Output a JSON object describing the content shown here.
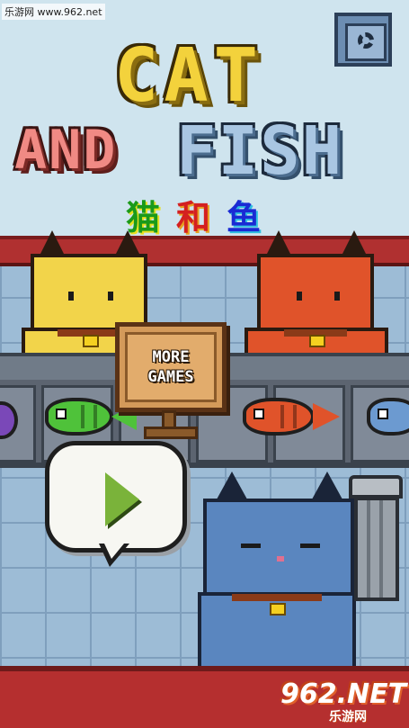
{
  "watermark": {
    "site": "乐游网 www.962.net"
  },
  "title": {
    "line1": "CAT",
    "line2_left": "AND",
    "line2_right": "FISH",
    "chinese": [
      "猫",
      "和",
      "鱼"
    ]
  },
  "buttons": {
    "more_games": "MORE GAMES",
    "settings_icon": "gear-icon",
    "play_icon": "play-icon"
  },
  "brand": {
    "logo_main": "962.NET",
    "logo_sub": "乐游网"
  },
  "colors": {
    "cat_yellow": "#f2d44a",
    "cat_orange": "#e0532a",
    "cat_blue": "#5a86bf",
    "fish_green": "#4fc23a",
    "fish_red": "#e0532a",
    "fish_blue": "#6c9ad0",
    "title_yellow": "#f3d23c",
    "title_pink": "#f08a84",
    "title_blue": "#a9c6e2"
  }
}
